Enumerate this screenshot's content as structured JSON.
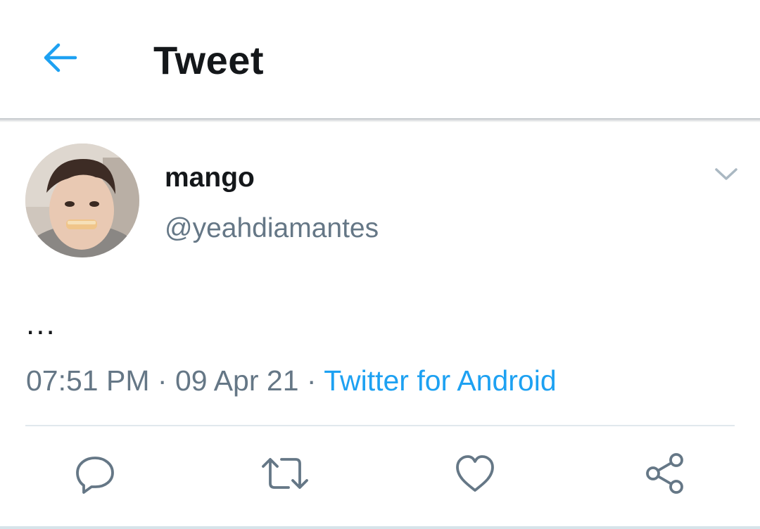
{
  "header": {
    "title": "Tweet",
    "back_icon": "arrow-left-icon"
  },
  "author": {
    "display_name": "mango",
    "handle": "@yeahdiamantes"
  },
  "tweet": {
    "text": "...",
    "time": "07:51 PM",
    "separator": "·",
    "date": "09 Apr 21",
    "source": "Twitter for Android"
  },
  "actions": {
    "reply_icon": "reply-icon",
    "retweet_icon": "retweet-icon",
    "like_icon": "heart-icon",
    "share_icon": "share-icon"
  },
  "colors": {
    "accent": "#1da1f2",
    "text_primary": "#14171a",
    "text_secondary": "#657786",
    "divider": "#e1e8ed"
  }
}
